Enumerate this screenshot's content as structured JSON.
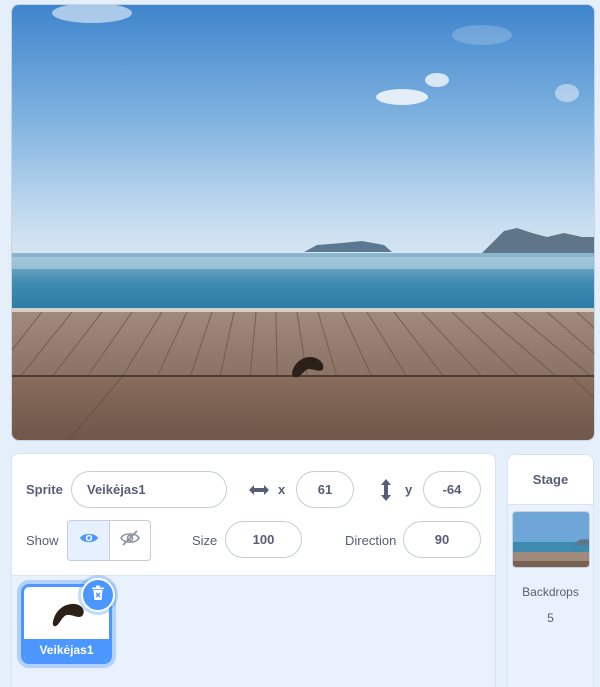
{
  "stage": {
    "scene": "seaside-boardwalk"
  },
  "sprite_info": {
    "sprite_label": "Sprite",
    "sprite_name": "Veikėjas1",
    "x_icon": "horizontal-arrows-icon",
    "x_label": "x",
    "x_value": "61",
    "y_icon": "vertical-arrows-icon",
    "y_label": "y",
    "y_value": "-64",
    "show_label": "Show",
    "show_visible_icon": "eye-icon",
    "show_hidden_icon": "eye-slash-icon",
    "size_label": "Size",
    "size_value": "100",
    "direction_label": "Direction",
    "direction_value": "90"
  },
  "sprite_list": {
    "items": [
      {
        "name": "Veikėjas1",
        "selected": true,
        "delete_icon": "trash-icon"
      }
    ]
  },
  "stage_target": {
    "title": "Stage",
    "backdrops_label": "Backdrops",
    "backdrops_count": "5"
  },
  "colors": {
    "accent": "#4c97ff",
    "text": "#575e75",
    "background": "#e5effa"
  }
}
